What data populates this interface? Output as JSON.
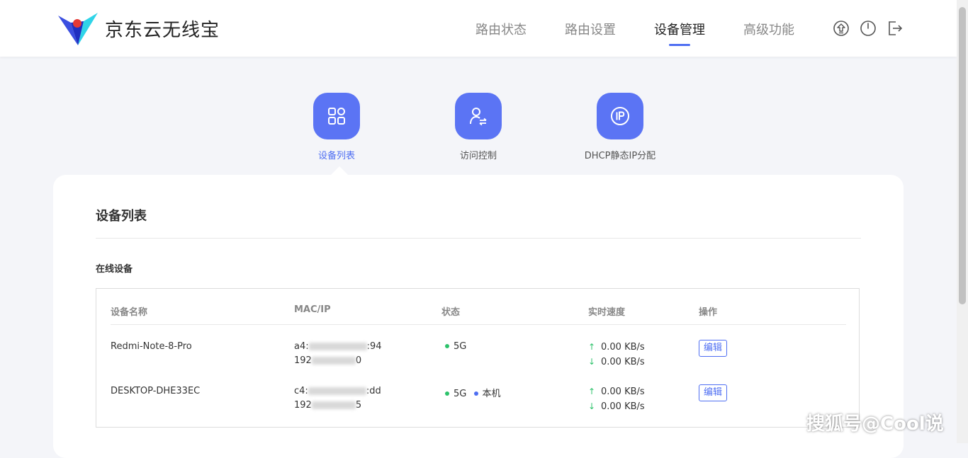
{
  "header": {
    "brand": "京东云无线宝",
    "nav": [
      {
        "label": "路由状态"
      },
      {
        "label": "路由设置"
      },
      {
        "label": "设备管理"
      },
      {
        "label": "高级功能"
      }
    ],
    "icons": [
      "upgrade-icon",
      "power-icon",
      "logout-icon"
    ]
  },
  "categories": [
    {
      "label": "设备列表",
      "icon": "grid-icon"
    },
    {
      "label": "访问控制",
      "icon": "user-transfer-icon"
    },
    {
      "label": "DHCP静态IP分配",
      "icon": "ip-icon"
    }
  ],
  "card": {
    "title": "设备列表",
    "section": "在线设备",
    "columns": [
      "设备名称",
      "MAC/IP",
      "状态",
      "实时速度",
      "操作"
    ],
    "rows": [
      {
        "name": "Redmi-Note-8-Pro",
        "mac_prefix": "a4:",
        "mac_suffix": ":94",
        "ip_prefix": "192",
        "ip_suffix": "0",
        "band": "5G",
        "local": "",
        "up": "0.00 KB/s",
        "down": "0.00 KB/s",
        "action": "编辑"
      },
      {
        "name": "DESKTOP-DHE33EC",
        "mac_prefix": "c4:",
        "mac_suffix": ":dd",
        "ip_prefix": "192",
        "ip_suffix": "5",
        "band": "5G",
        "local": "本机",
        "up": "0.00 KB/s",
        "down": "0.00 KB/s",
        "action": "编辑"
      }
    ]
  },
  "colors": {
    "accent": "#4e6ef2",
    "category_bg": "#5b74f4",
    "status_green": "#2dc26b",
    "status_blue": "#4e6ef2",
    "page_bg": "#f4f5f9"
  },
  "watermark": "搜狐号@Cool说"
}
